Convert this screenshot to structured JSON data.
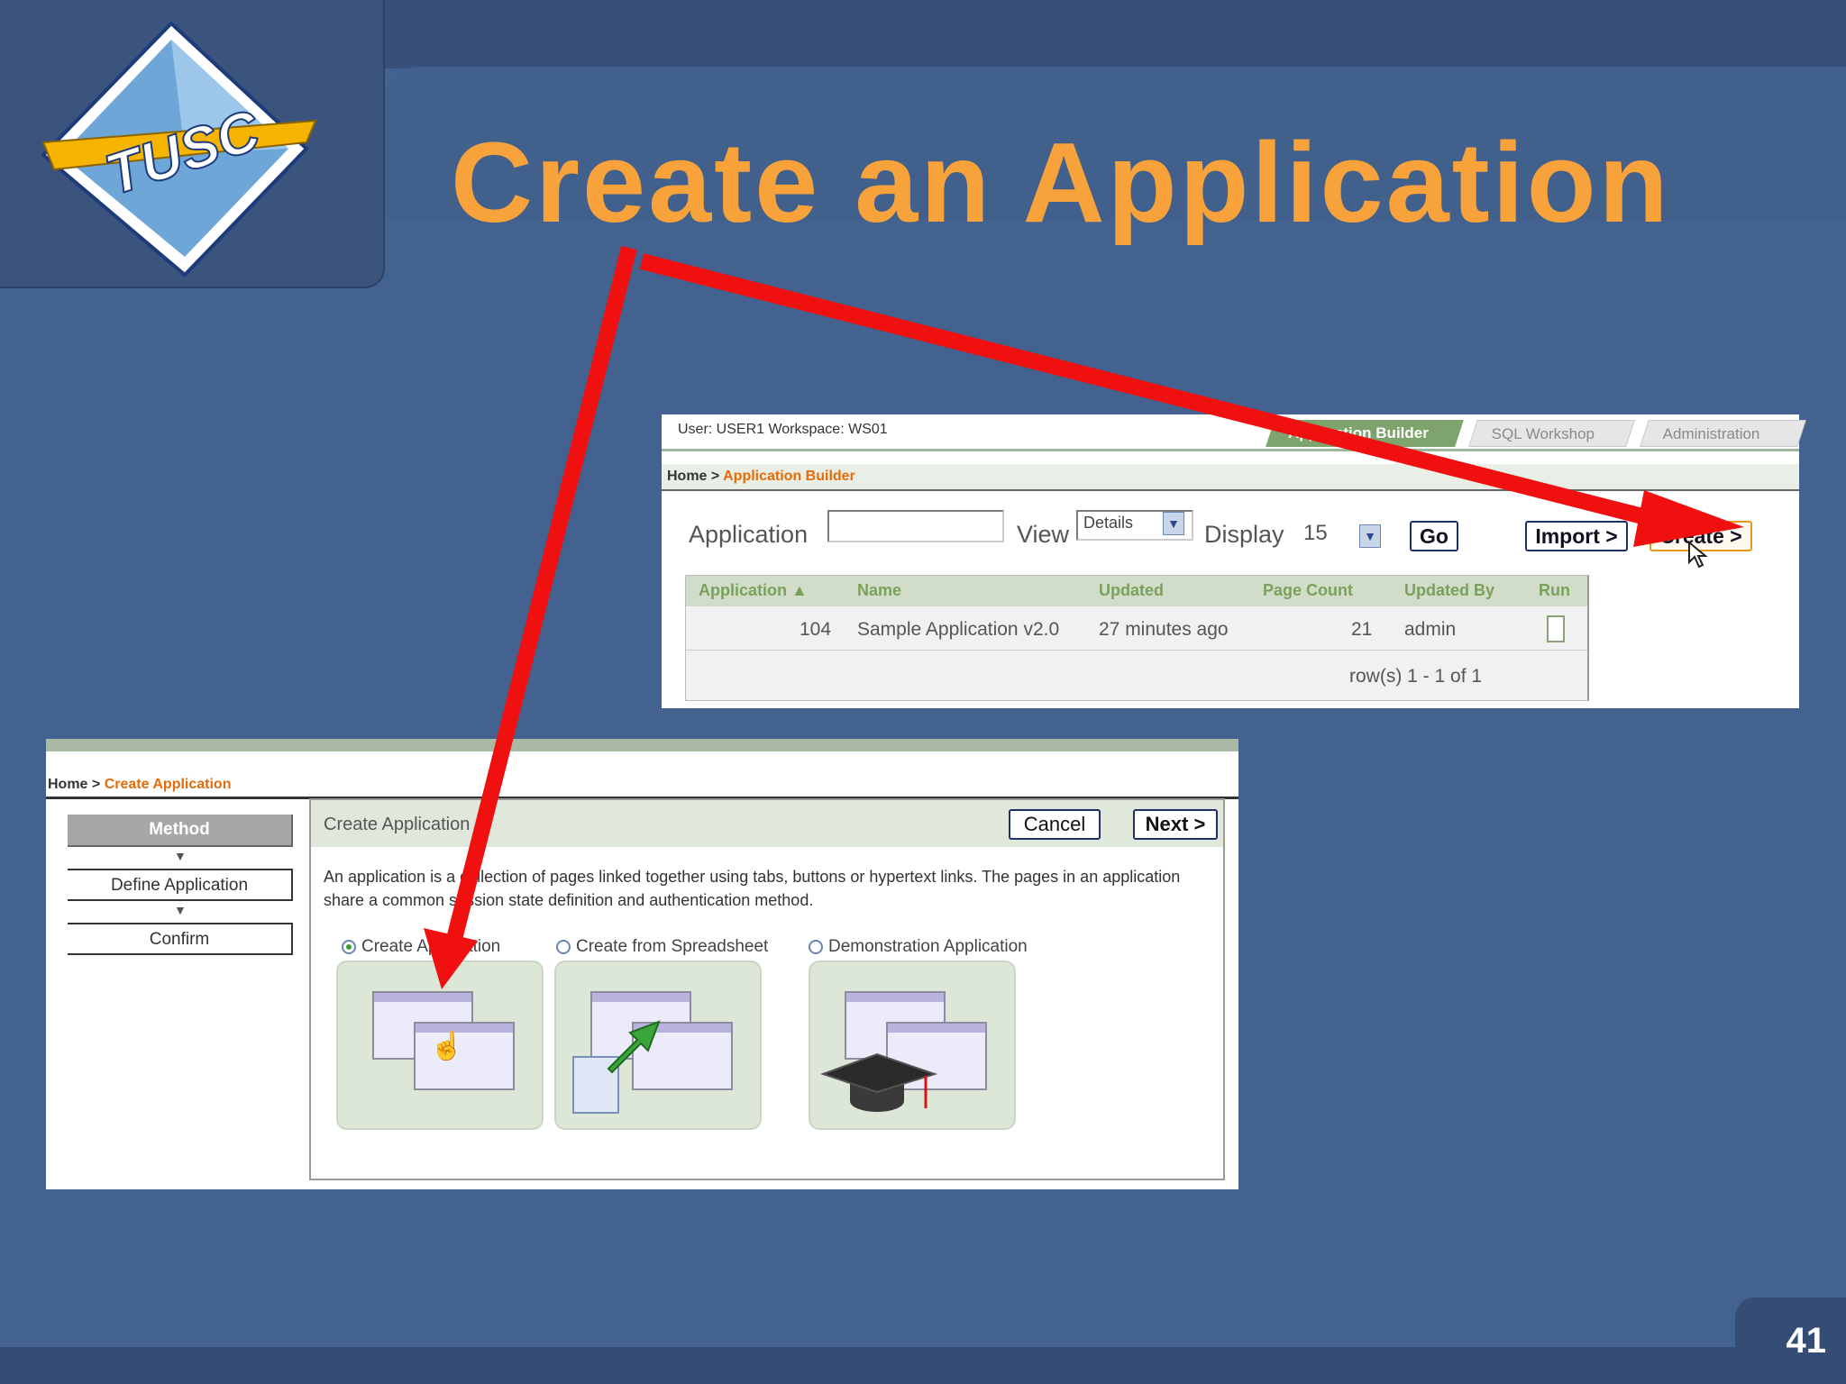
{
  "slide": {
    "title": "Create an Application",
    "logo_text": "TUSC",
    "page_number": "41"
  },
  "colors": {
    "title": "#f7a23a",
    "background": "#44628f",
    "arrow": "#f01010"
  },
  "app_builder": {
    "user_line": "User: USER1 Workspace: WS01",
    "tabs": [
      "Application Builder",
      "SQL Workshop",
      "Administration"
    ],
    "breadcrumb_home": "Home >",
    "breadcrumb_current": "Application Builder",
    "search_label": "Application",
    "view_label": "View",
    "view_value": "Details",
    "display_label": "Display",
    "display_value": "15",
    "go_label": "Go",
    "import_label": "Import >",
    "create_label": "Create >",
    "columns": [
      "Application ▲",
      "Name",
      "Updated",
      "Page Count",
      "Updated By",
      "Run"
    ],
    "rows": [
      {
        "application": "104",
        "name": "Sample Application v2.0",
        "updated": "27 minutes ago",
        "page_count": "21",
        "updated_by": "admin"
      }
    ],
    "rows_info": "row(s) 1 - 1 of 1"
  },
  "create_app": {
    "breadcrumb_home": "Home >",
    "breadcrumb_current": "Create Application",
    "steps": [
      "Method",
      "Define Application",
      "Confirm"
    ],
    "panel_title": "Create Application",
    "cancel_label": "Cancel",
    "next_label": "Next >",
    "description": "An application is a collection of pages linked together using tabs, buttons or hypertext links. The pages in an application share a common session state definition and authentication method.",
    "options": [
      "Create Application",
      "Create from Spreadsheet",
      "Demonstration Application"
    ],
    "selected_option": "Create Application"
  }
}
